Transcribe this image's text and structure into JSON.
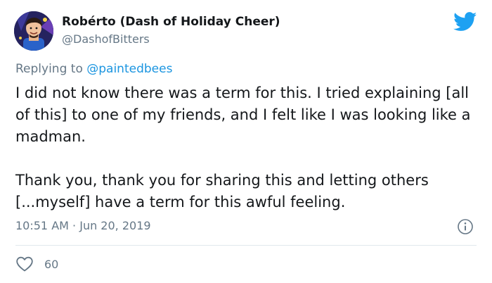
{
  "author": {
    "display_name": "Robérto (Dash of Holiday Cheer)",
    "handle": "@DashofBitters",
    "avatar_icon": "cartoon-man-avatar"
  },
  "reply": {
    "prefix": "Replying to ",
    "mention": "@paintedbees"
  },
  "body": {
    "paragraph_1": "I did not know there was a term for this. I tried explaining [all of this] to one of my friends, and I felt like I was looking like a madman.",
    "paragraph_2": "Thank you, thank you for sharing this and letting others [...myself] have a term for this awful feeling."
  },
  "meta": {
    "time": "10:51 AM",
    "separator": " · ",
    "date": "Jun 20, 2019"
  },
  "stats": {
    "likes": "60"
  },
  "colors": {
    "twitter_blue": "#1da1f2",
    "secondary_text": "#657786",
    "divider": "#e1e8ed"
  },
  "icons": {
    "brand": "twitter-bird-icon",
    "info": "info-icon",
    "like": "heart-icon"
  }
}
